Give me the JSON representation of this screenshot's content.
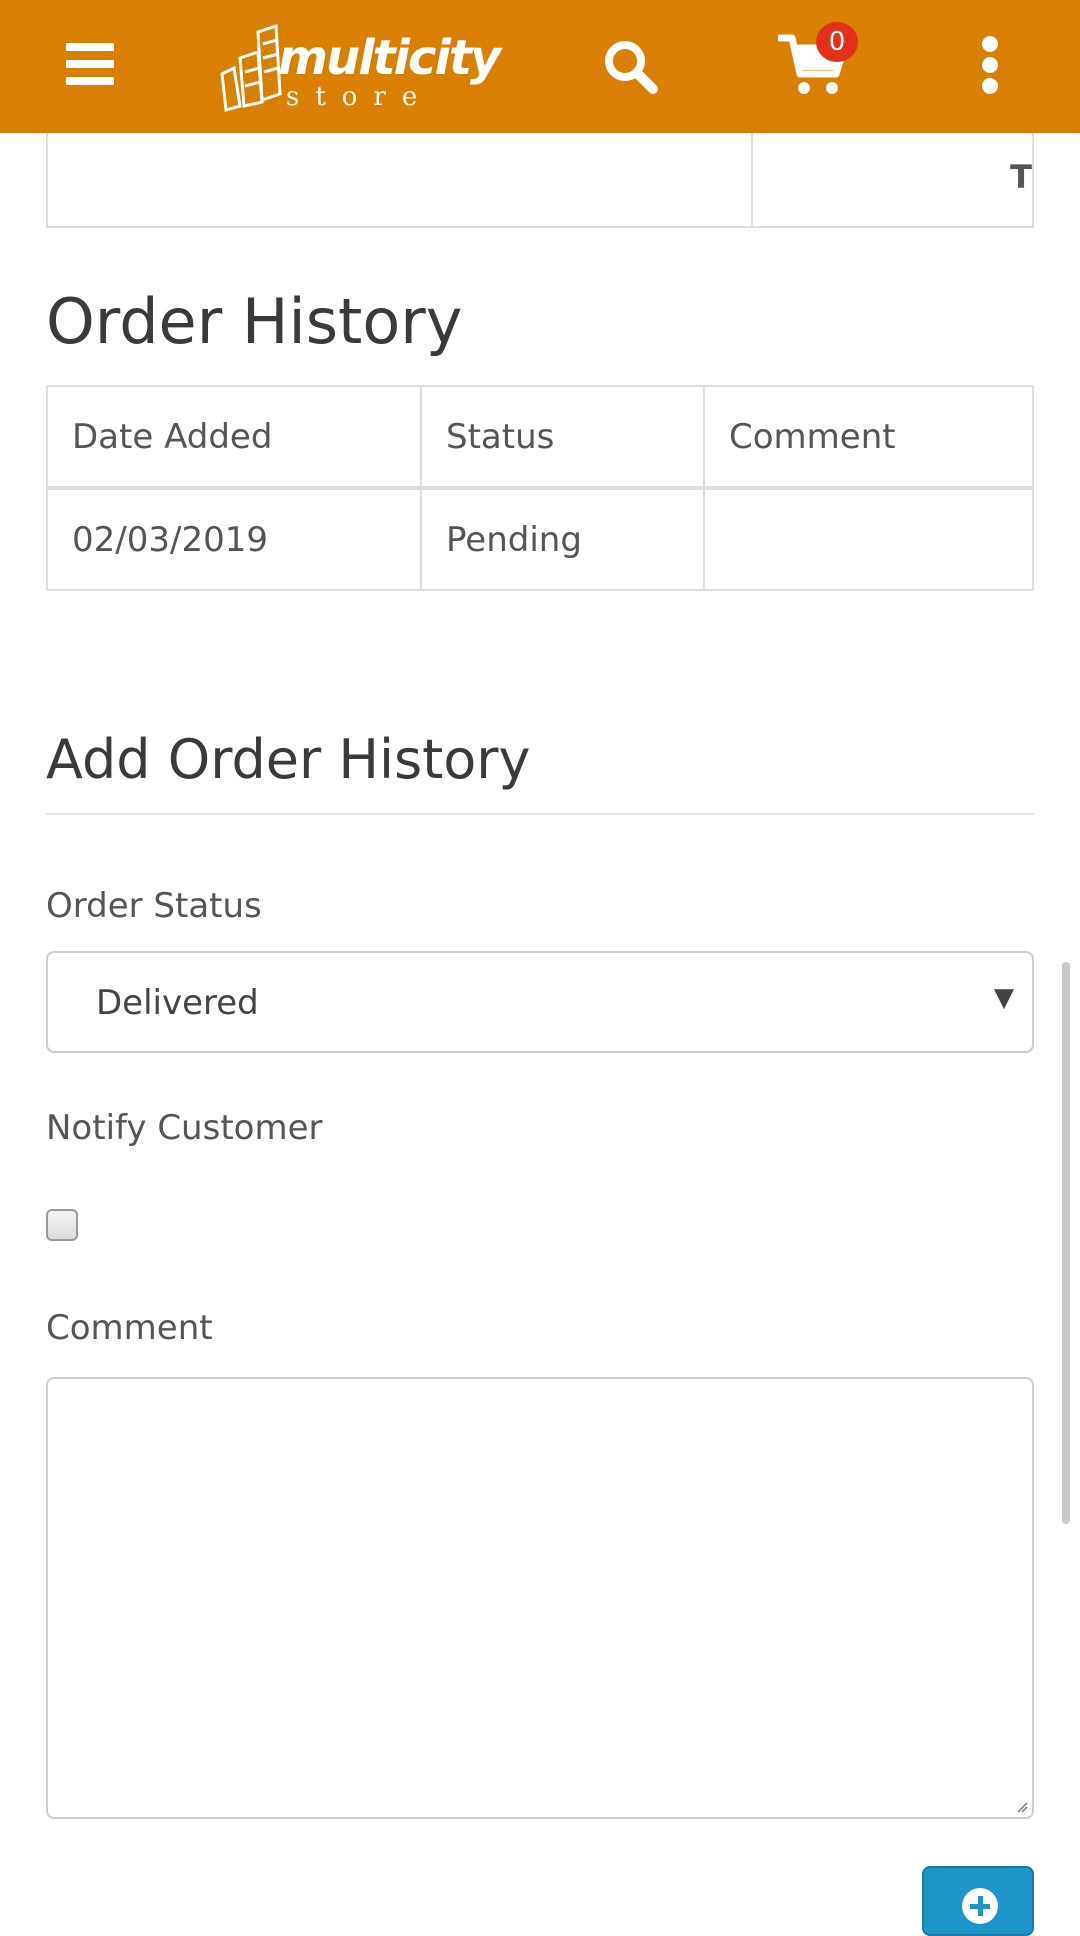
{
  "header": {
    "logo_word": "multicity",
    "logo_sub": "store",
    "cart_count": "0",
    "bg_color": "#d97f02"
  },
  "partial_table": {
    "right_cell_text": "T"
  },
  "order_history": {
    "title": "Order History",
    "columns": [
      "Date Added",
      "Status",
      "Comment"
    ],
    "rows": [
      [
        "02/03/2019",
        "Pending",
        ""
      ]
    ]
  },
  "add_history": {
    "title": "Add Order History",
    "order_status_label": "Order Status",
    "order_status_value": "Delivered",
    "notify_label": "Notify Customer",
    "comment_label": "Comment",
    "button_color": "#1e95c9"
  }
}
